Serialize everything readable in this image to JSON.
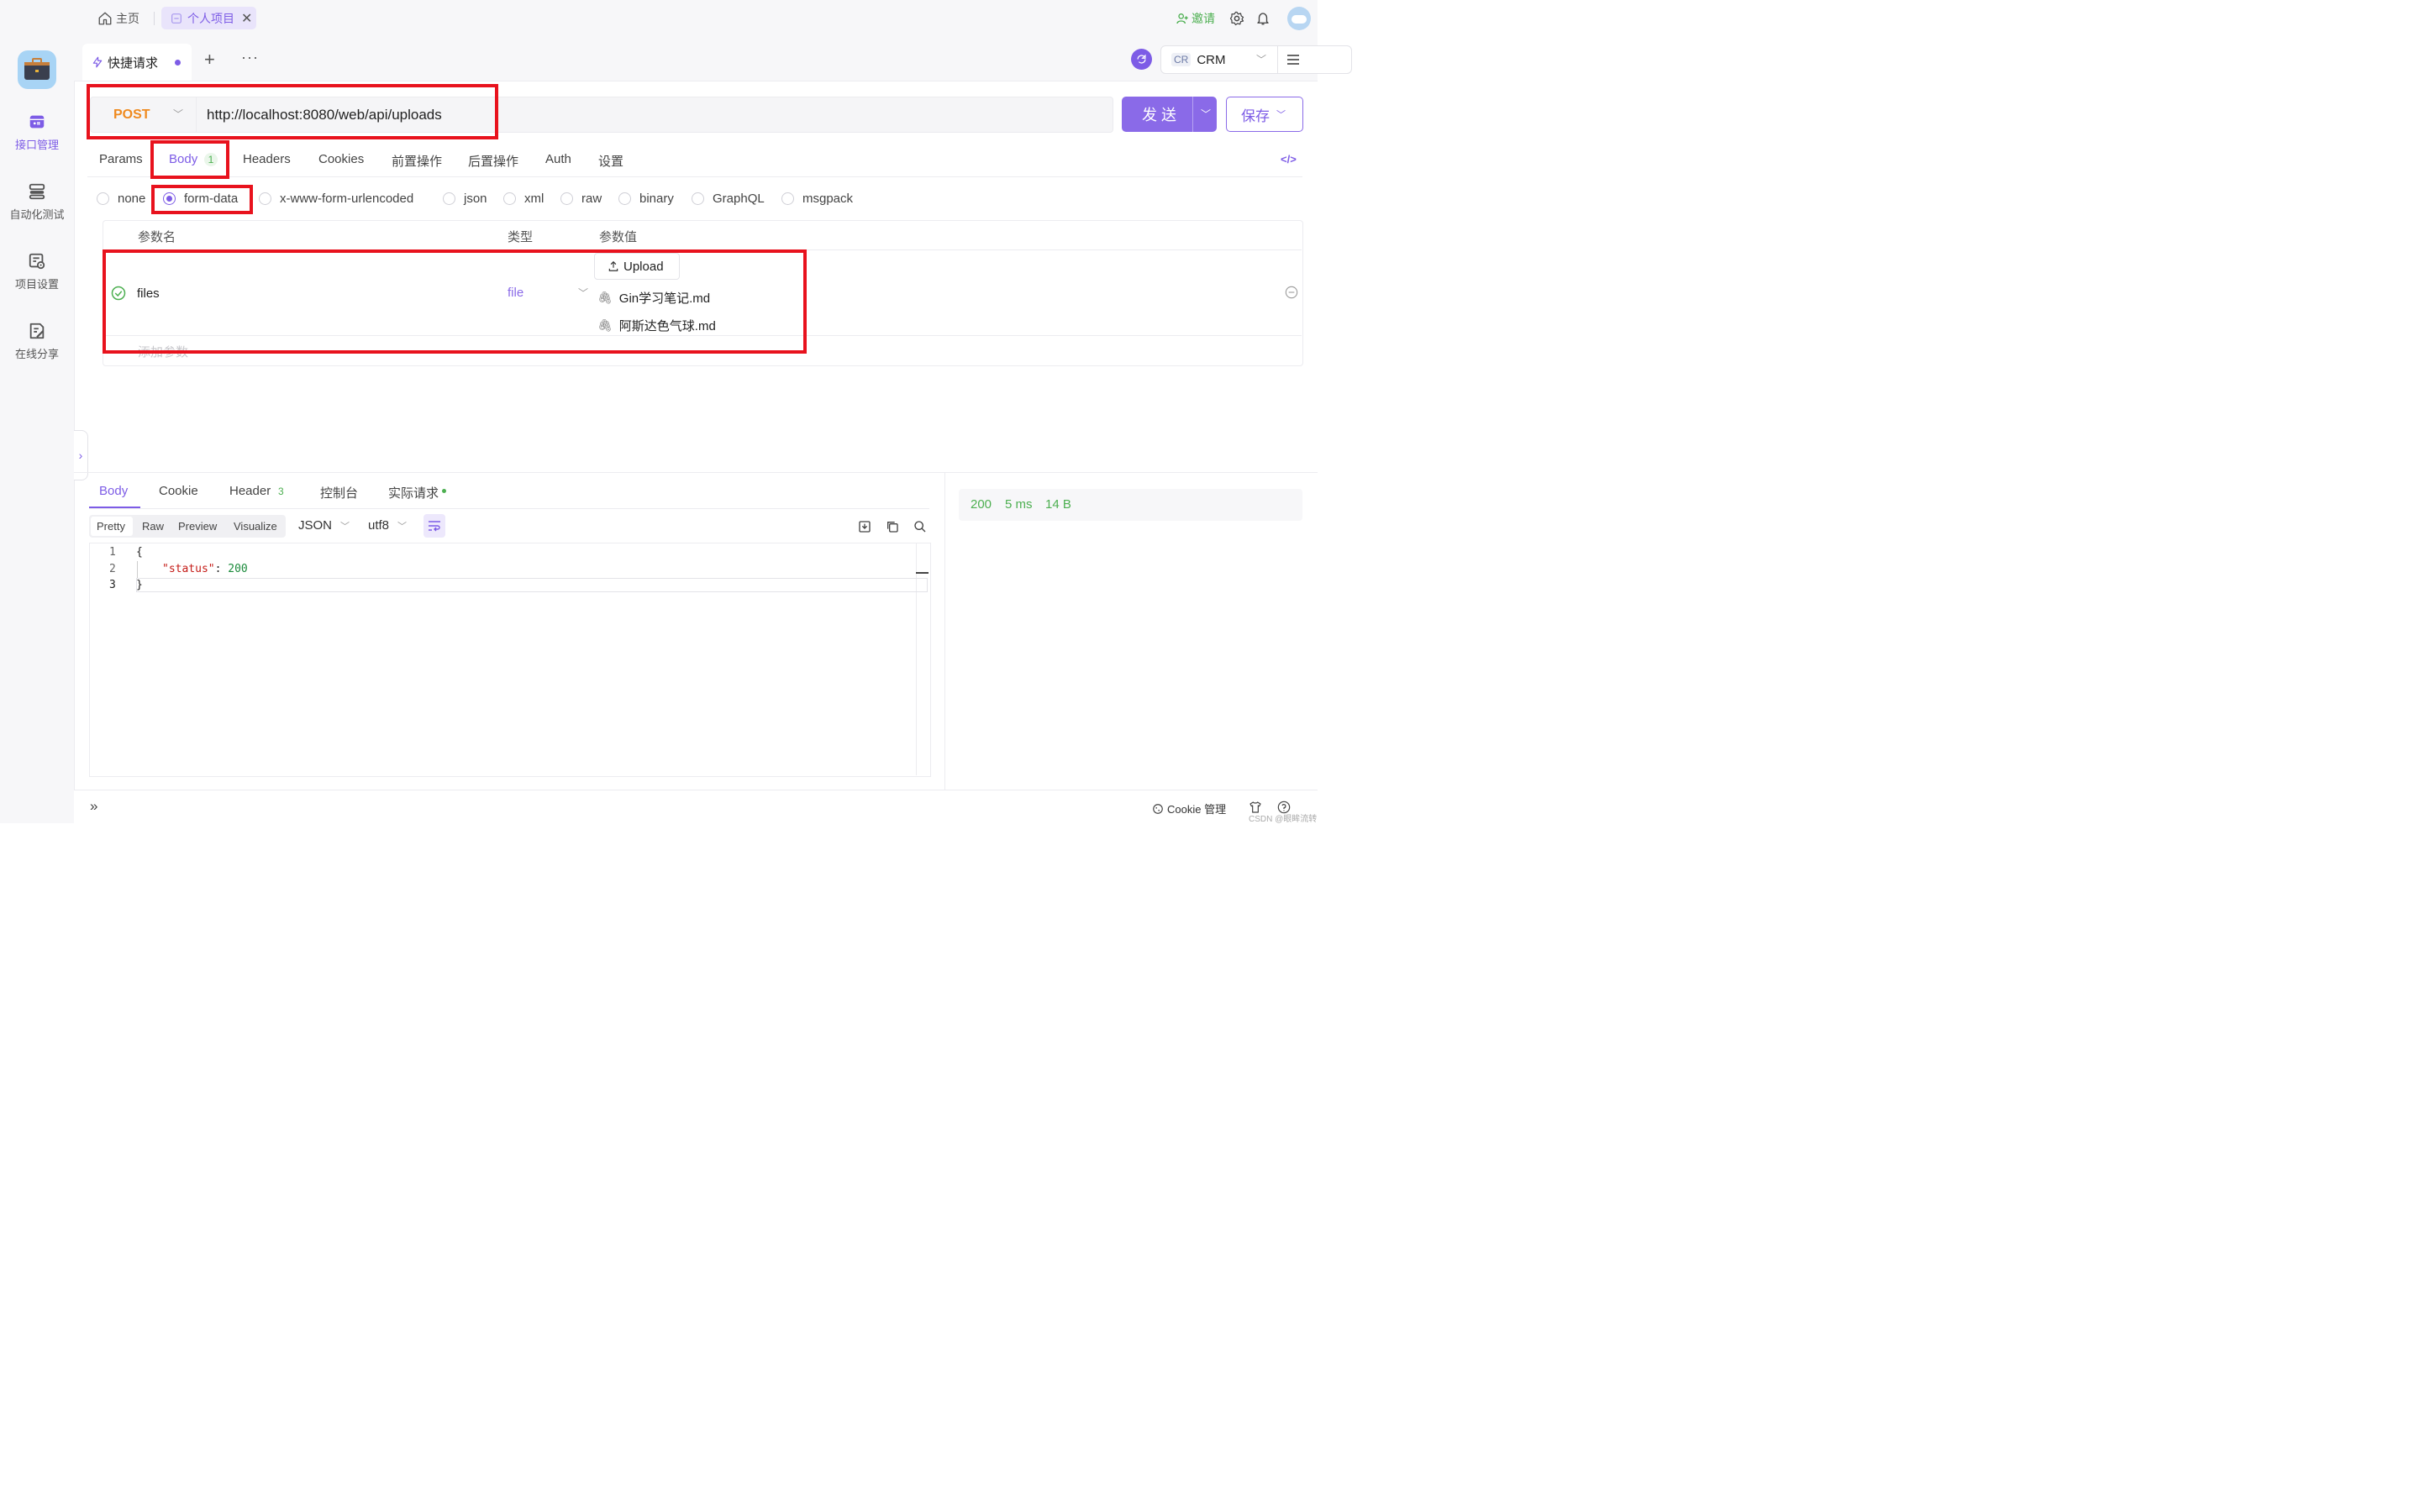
{
  "topbar": {
    "home_tab": "主页",
    "project_tab": "个人项目",
    "invite": "邀请"
  },
  "sidebar": {
    "items": [
      {
        "label": "接口管理",
        "icon": "api-management-icon",
        "active": true
      },
      {
        "label": "自动化测试",
        "icon": "automation-test-icon"
      },
      {
        "label": "项目设置",
        "icon": "project-settings-icon"
      },
      {
        "label": "在线分享",
        "icon": "online-share-icon"
      }
    ]
  },
  "request_tab": {
    "title": "快捷请求"
  },
  "environment": {
    "badge": "CR",
    "name": "CRM"
  },
  "request": {
    "method": "POST",
    "url": "http://localhost:8080/web/api/uploads",
    "send_label": "发 送",
    "save_label": "保存"
  },
  "req_tabs": [
    {
      "label": "Params"
    },
    {
      "label": "Body",
      "badge": "1",
      "active": true
    },
    {
      "label": "Headers"
    },
    {
      "label": "Cookies"
    },
    {
      "label": "前置操作"
    },
    {
      "label": "后置操作"
    },
    {
      "label": "Auth"
    },
    {
      "label": "设置"
    }
  ],
  "body_types": [
    "none",
    "form-data",
    "x-www-form-urlencoded",
    "json",
    "xml",
    "raw",
    "binary",
    "GraphQL",
    "msgpack"
  ],
  "body_type_selected": "form-data",
  "params_table": {
    "headers": {
      "name": "参数名",
      "type": "类型",
      "value": "参数值"
    },
    "rows": [
      {
        "name": "files",
        "type": "file",
        "upload_label": "Upload",
        "files": [
          "Gin学习笔记.md",
          "阿斯达色气球.md"
        ]
      }
    ],
    "add_placeholder": "添加参数"
  },
  "response_tabs": [
    {
      "label": "Body",
      "active": true
    },
    {
      "label": "Cookie"
    },
    {
      "label": "Header",
      "badge": "3"
    },
    {
      "label": "控制台"
    },
    {
      "label": "实际请求"
    }
  ],
  "response_view": {
    "modes": [
      "Pretty",
      "Raw",
      "Preview",
      "Visualize"
    ],
    "format": "JSON",
    "encoding": "utf8"
  },
  "code": {
    "line_numbers": [
      "1",
      "2",
      "3"
    ],
    "open_brace": "{",
    "key": "\"status\"",
    "colon": ": ",
    "value": "200",
    "close_brace": "}"
  },
  "status": {
    "code": "200",
    "time": "5 ms",
    "size": "14 B"
  },
  "footer": {
    "cookie_manage": "Cookie 管理",
    "watermark": "CSDN @眼眸流转"
  },
  "colors": {
    "accent": "#7d5ce6",
    "method": "#ef8a1f",
    "highlight": "#e8121d",
    "success": "#4caf50",
    "invite": "#4caf50"
  }
}
